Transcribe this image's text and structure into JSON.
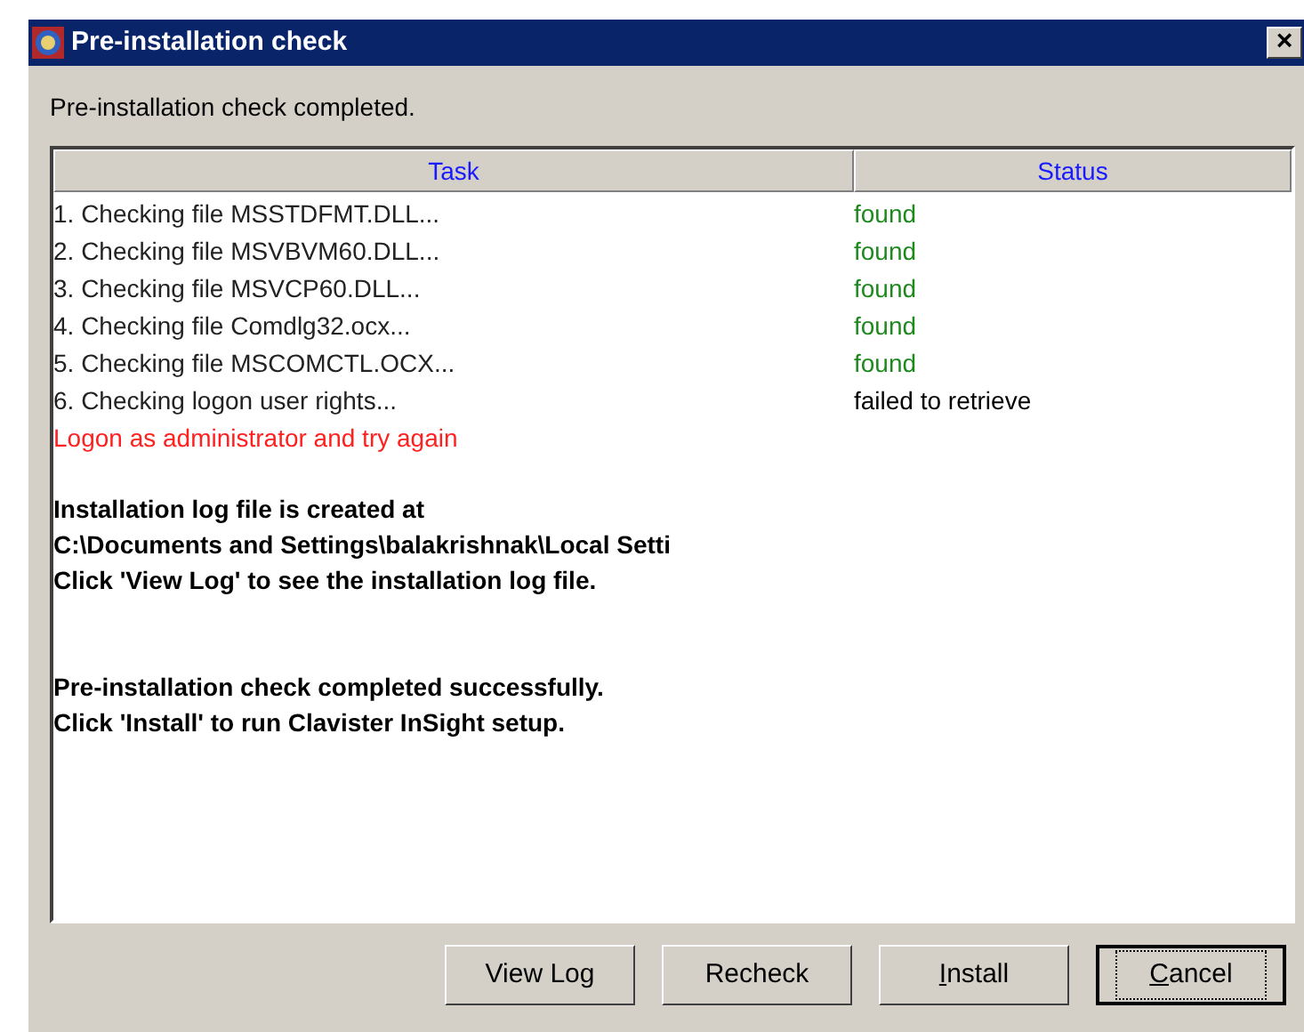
{
  "window": {
    "title": "Pre-installation check",
    "close_glyph": "×"
  },
  "summary": "Pre-installation check completed.",
  "table": {
    "columns": [
      "Task",
      "Status"
    ],
    "rows": [
      {
        "kind": "check",
        "task": "1. Checking file MSSTDFMT.DLL...",
        "status": "found",
        "color": "#1e8a1e"
      },
      {
        "kind": "check",
        "task": "2. Checking file MSVBVM60.DLL...",
        "status": "found",
        "color": "#1e8a1e"
      },
      {
        "kind": "check",
        "task": "3. Checking file MSVCP60.DLL...",
        "status": "found",
        "color": "#1e8a1e"
      },
      {
        "kind": "check",
        "task": "4. Checking file Comdlg32.ocx...",
        "status": "found",
        "color": "#1e8a1e"
      },
      {
        "kind": "check",
        "task": "5. Checking file MSCOMCTL.OCX...",
        "status": "found",
        "color": "#1e8a1e"
      },
      {
        "kind": "check",
        "task": "6. Checking logon user rights...",
        "status": "failed to retrieve",
        "color": "#000000"
      },
      {
        "kind": "message",
        "text": "Logon as administrator and try again",
        "color": "#ff2020"
      }
    ],
    "log_blocks": [
      [
        "Installation log file is created at",
        "C:\\Documents and Settings\\balakrishnak\\Local Setti",
        "Click 'View Log' to see the installation log file."
      ],
      [
        "Pre-installation check completed successfully.",
        "Click 'Install' to run Clavister InSight setup."
      ]
    ]
  },
  "buttons": [
    {
      "label": "View Log",
      "underline_first": false,
      "default": false
    },
    {
      "label": "Recheck",
      "underline_first": false,
      "default": false
    },
    {
      "label": "Install",
      "underline_first": true,
      "default": false
    },
    {
      "label": "Cancel",
      "underline_first": true,
      "default": true
    }
  ]
}
